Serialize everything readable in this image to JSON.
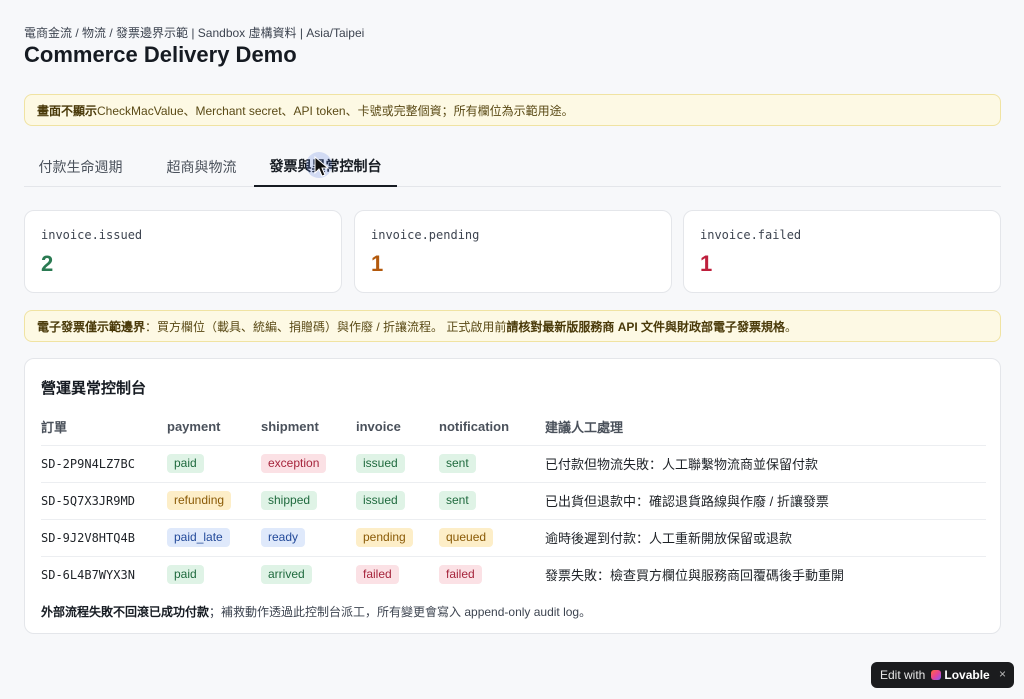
{
  "breadcrumb": "電商金流 / 物流 / 發票邊界示範 | Sandbox 虛構資料 | Asia/Taipei",
  "title": "Commerce Delivery Demo",
  "notice_top": {
    "bold": "畫面不顯示",
    "text": " CheckMacValue、Merchant secret、API token、卡號或完整個資；所有欄位為示範用途。"
  },
  "tabs": [
    {
      "label": "付款生命週期"
    },
    {
      "label": "超商與物流"
    },
    {
      "label": "發票與異常控制台"
    }
  ],
  "stats": [
    {
      "label": "invoice.issued",
      "value": "2",
      "color": "#2a7a52"
    },
    {
      "label": "invoice.pending",
      "value": "1",
      "color": "#b3590c"
    },
    {
      "label": "invoice.failed",
      "value": "1",
      "color": "#be1f3c"
    }
  ],
  "notice_mid": {
    "bold1": "電子發票僅示範邊界",
    "text1": "：買方欄位（載具、統編、捐贈碼）與作廢 / 折讓流程。 正式啟用前",
    "bold2": "請核對最新版服務商 API 文件與財政部電子發票規格",
    "text2": "。"
  },
  "console": {
    "title": "營運異常控制台",
    "headers": [
      "訂單",
      "payment",
      "shipment",
      "invoice",
      "notification",
      "建議人工處理"
    ],
    "rows": [
      {
        "order": "SD-2P9N4LZ7BC",
        "payment": {
          "text": "paid",
          "tone": "green"
        },
        "shipment": {
          "text": "exception",
          "tone": "red"
        },
        "invoice": {
          "text": "issued",
          "tone": "green"
        },
        "notification": {
          "text": "sent",
          "tone": "green"
        },
        "action": "已付款但物流失敗：人工聯繫物流商並保留付款"
      },
      {
        "order": "SD-5Q7X3JR9MD",
        "payment": {
          "text": "refunding",
          "tone": "amber"
        },
        "shipment": {
          "text": "shipped",
          "tone": "green"
        },
        "invoice": {
          "text": "issued",
          "tone": "green"
        },
        "notification": {
          "text": "sent",
          "tone": "green"
        },
        "action": "已出貨但退款中：確認退貨路線與作廢 / 折讓發票"
      },
      {
        "order": "SD-9J2V8HTQ4B",
        "payment": {
          "text": "paid_late",
          "tone": "blue"
        },
        "shipment": {
          "text": "ready",
          "tone": "blue"
        },
        "invoice": {
          "text": "pending",
          "tone": "amber"
        },
        "notification": {
          "text": "queued",
          "tone": "amber"
        },
        "action": "逾時後遲到付款：人工重新開放保留或退款"
      },
      {
        "order": "SD-6L4B7WYX3N",
        "payment": {
          "text": "paid",
          "tone": "green"
        },
        "shipment": {
          "text": "arrived",
          "tone": "green"
        },
        "invoice": {
          "text": "failed",
          "tone": "red"
        },
        "notification": {
          "text": "failed",
          "tone": "red"
        },
        "action": "發票失敗：檢查買方欄位與服務商回覆碼後手動重開"
      }
    ],
    "footer_bold": "外部流程失敗不回滾已成功付款",
    "footer_text": "；補救動作透過此控制台派工，所有變更會寫入 append-only audit log。"
  },
  "badge_tones": {
    "green": {
      "bg": "#dff3e6",
      "fg": "#1f6a3e"
    },
    "red": {
      "bg": "#fbe1e5",
      "fg": "#a6253c"
    },
    "amber": {
      "bg": "#fdeec8",
      "fg": "#8a5a06"
    },
    "blue": {
      "bg": "#dfe9fb",
      "fg": "#234a9a"
    }
  },
  "lovable": {
    "edit_label": "Edit with",
    "brand": "Lovable",
    "close": "×"
  }
}
